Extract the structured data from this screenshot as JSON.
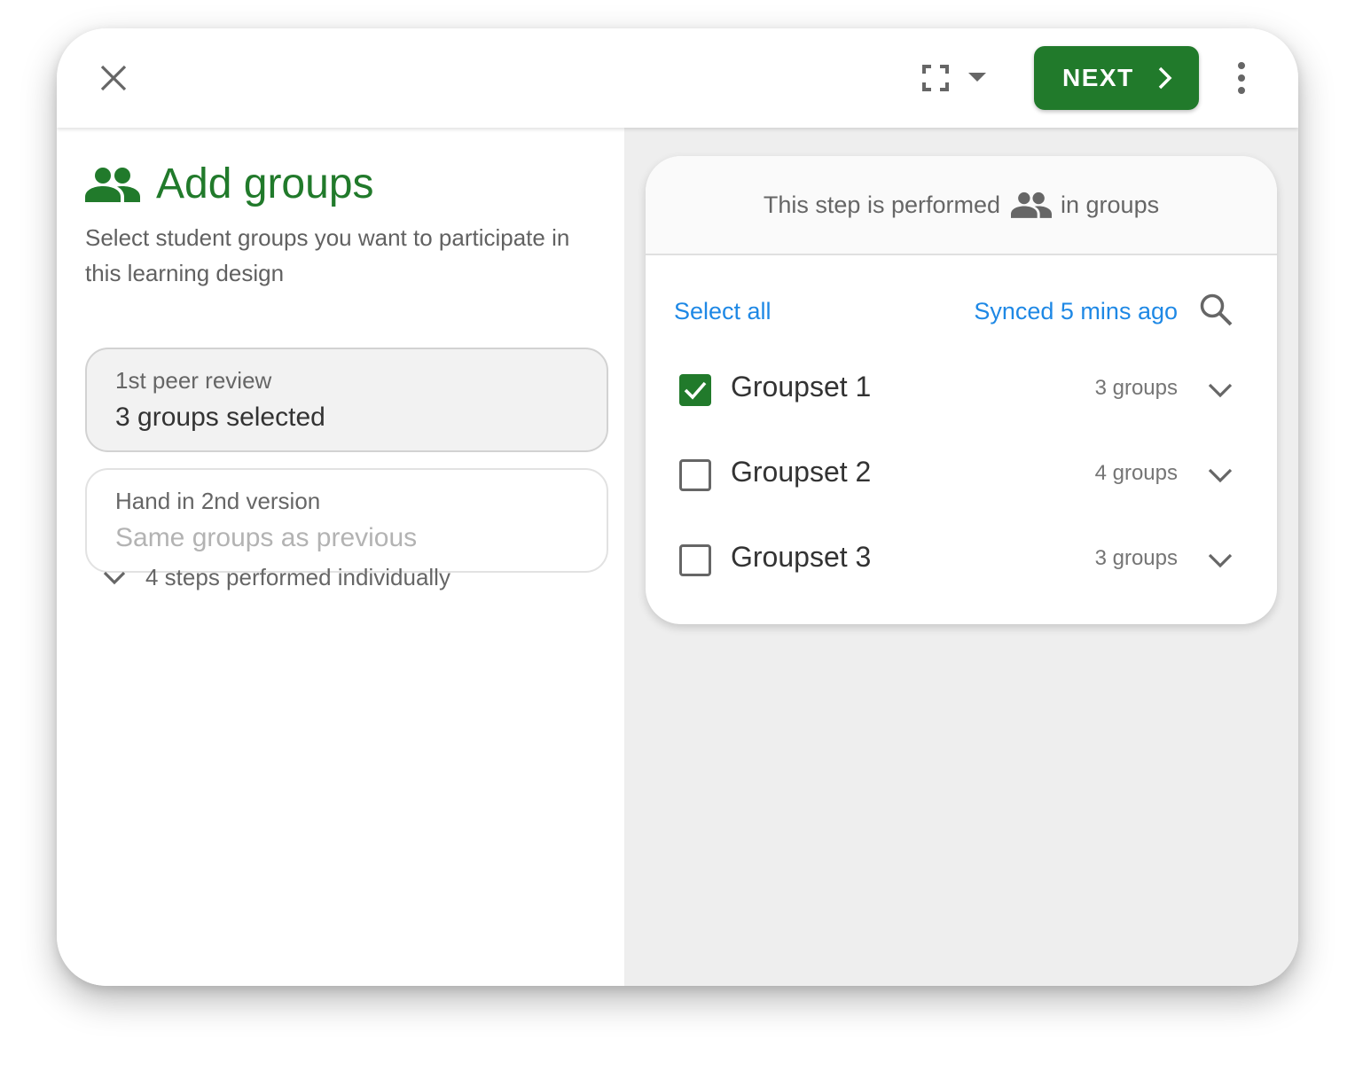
{
  "toolbar": {
    "close_icon": "close-icon",
    "view_icon": "fullscreen-icon",
    "next_label": "NEXT",
    "more_icon": "more-vert-icon",
    "accent": "#217a2b"
  },
  "left": {
    "title": "Add groups",
    "subtitle": "Select student groups you want to participate in this learning design",
    "steps": [
      {
        "title": "1st peer review",
        "value": "3 groups selected",
        "selected": true
      },
      {
        "title": "Hand in 2nd version",
        "value": "Same groups as previous",
        "selected": false
      }
    ],
    "individual_label": "4 steps performed individually"
  },
  "right": {
    "header_prefix": "This step is performed",
    "header_suffix": "in groups",
    "select_all": "Select all",
    "synced": "Synced 5 mins ago",
    "groupsets": [
      {
        "name": "Groupset 1",
        "count": "3 groups",
        "checked": true
      },
      {
        "name": "Groupset 2",
        "count": "4 groups",
        "checked": false
      },
      {
        "name": "Groupset 3",
        "count": "3 groups",
        "checked": false
      }
    ],
    "link_color": "#1e88e5"
  }
}
